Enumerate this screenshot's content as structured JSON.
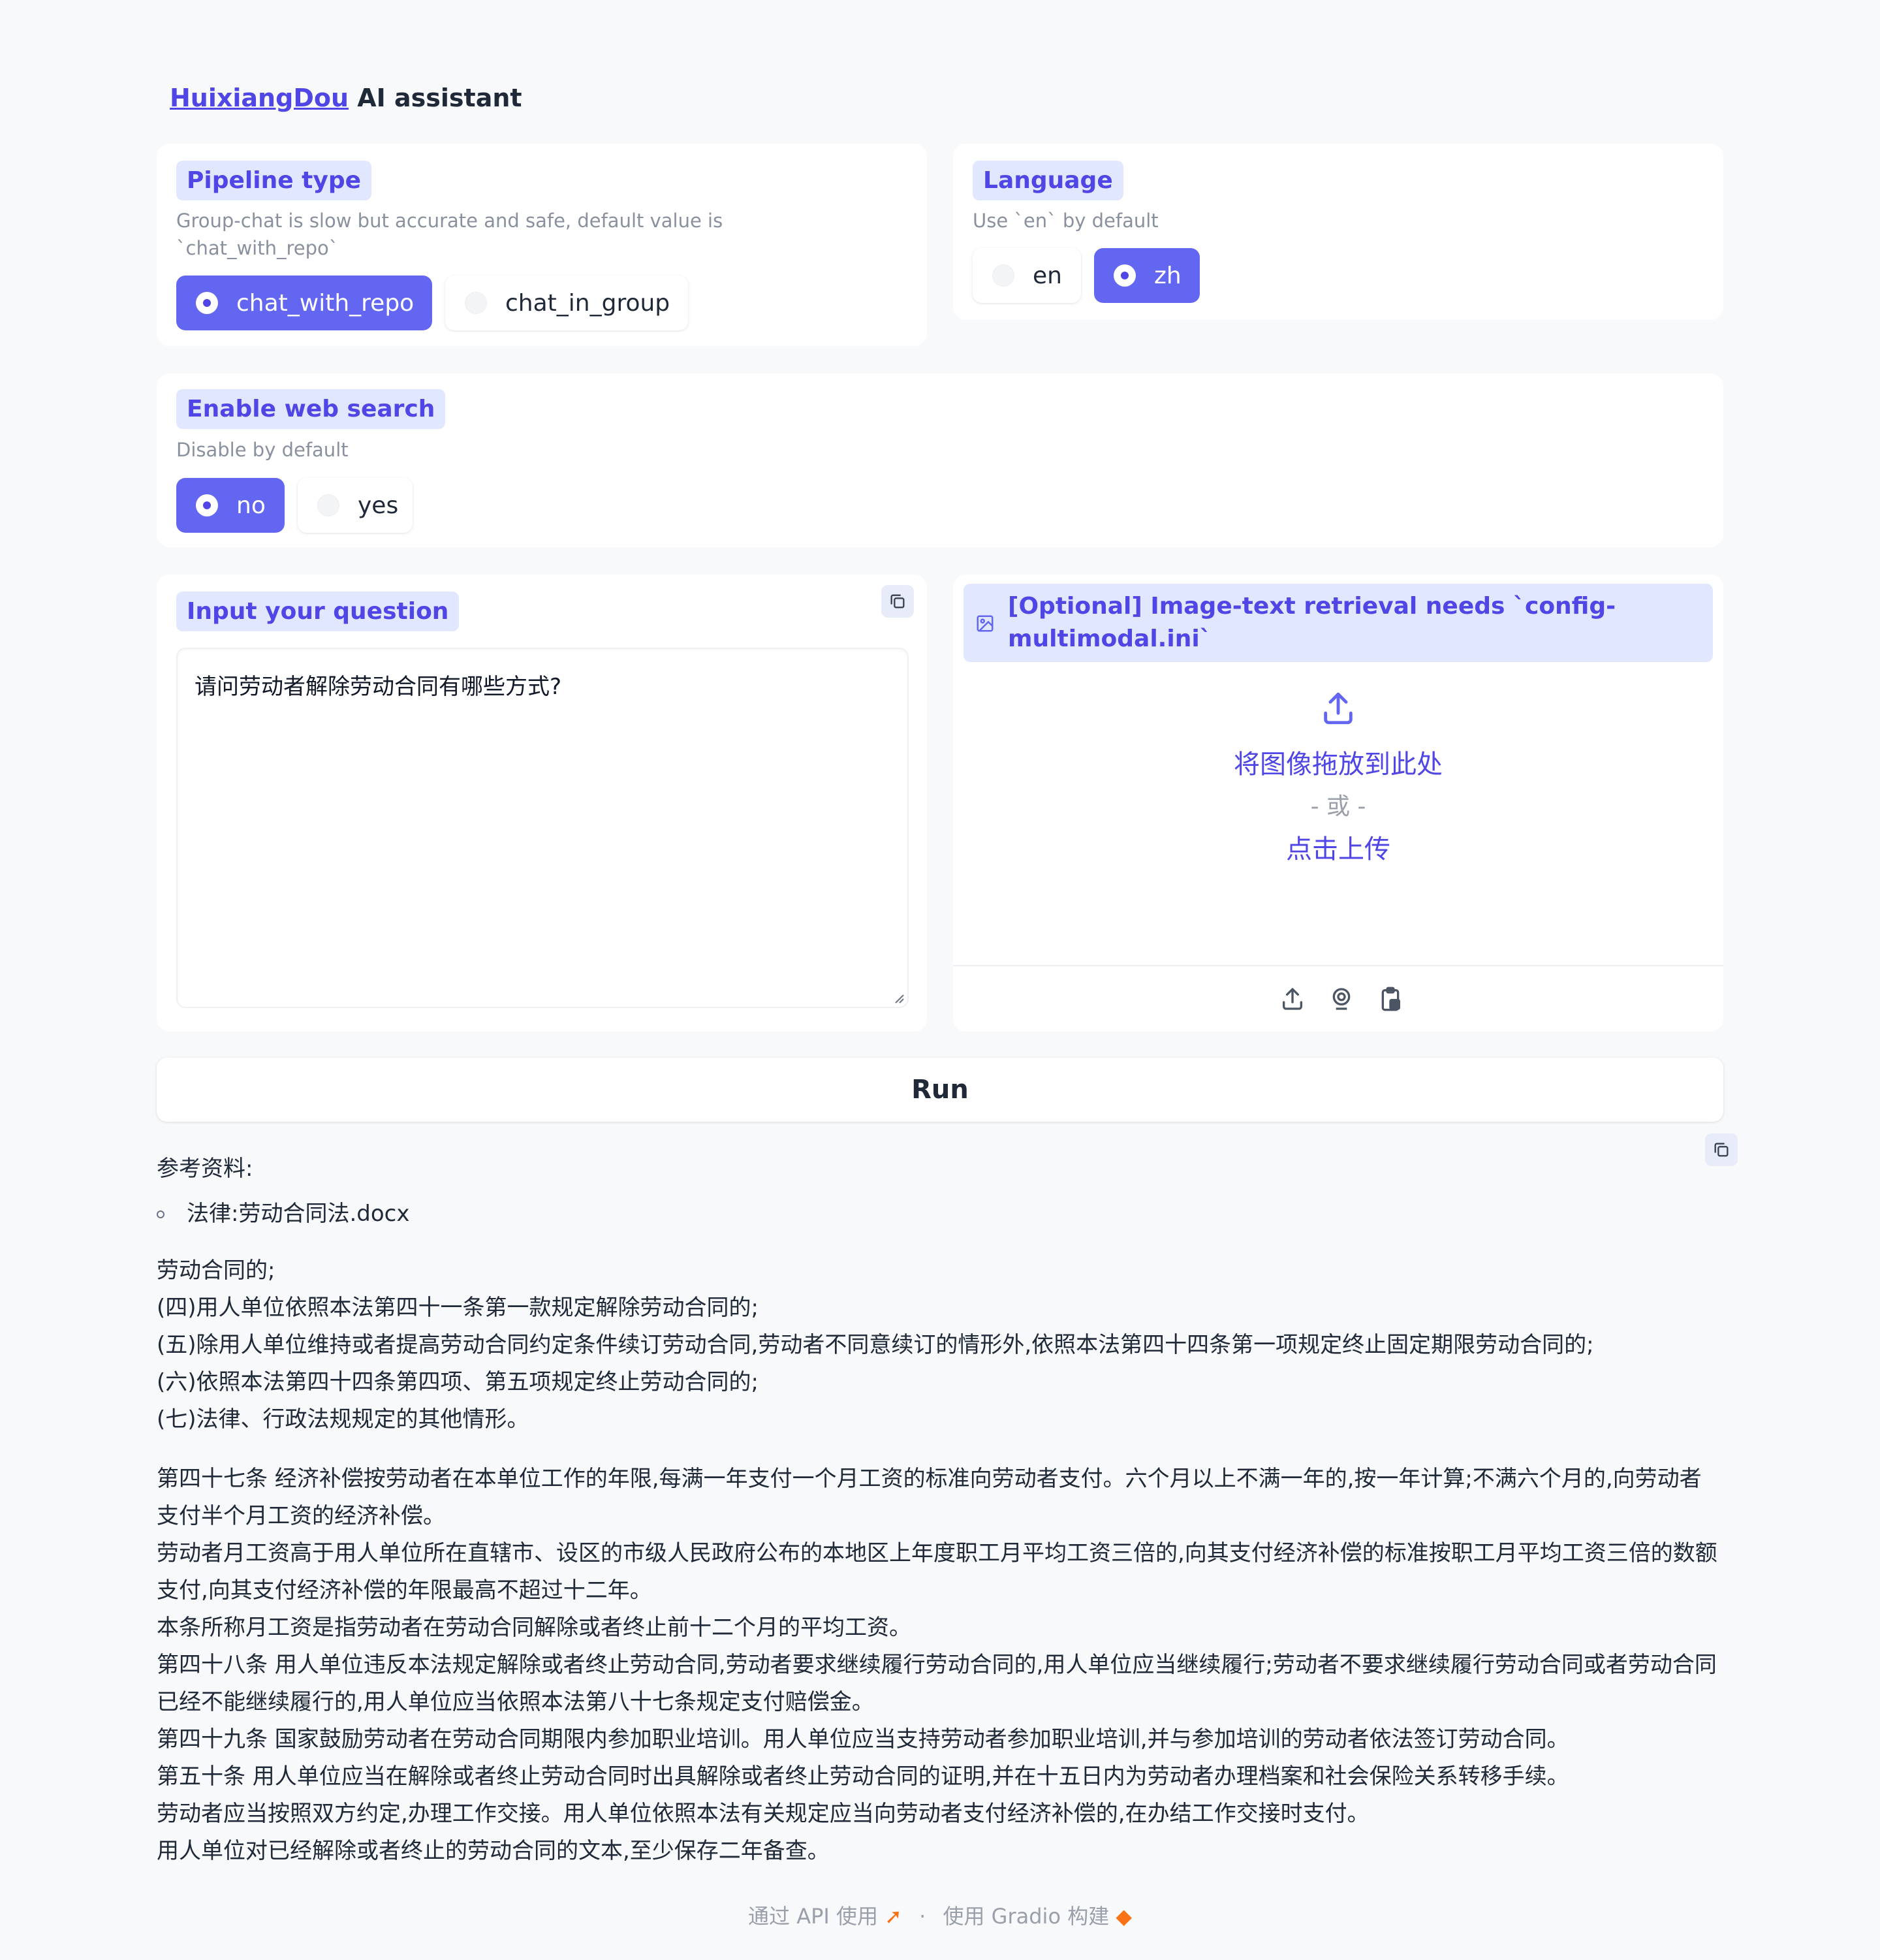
{
  "header": {
    "brand": "HuixiangDou",
    "suffix": " AI assistant"
  },
  "pipeline": {
    "label": "Pipeline type",
    "info_line1": "Group-chat is slow but accurate and safe, default value is",
    "info_line2": "`chat_with_repo`",
    "options": [
      "chat_with_repo",
      "chat_in_group"
    ],
    "selected": "chat_with_repo"
  },
  "language": {
    "label": "Language",
    "info": "Use `en` by default",
    "options": [
      "en",
      "zh"
    ],
    "selected": "zh"
  },
  "web_search": {
    "label": "Enable web search",
    "info": "Disable by default",
    "options": [
      "no",
      "yes"
    ],
    "selected": "no"
  },
  "question": {
    "label": "Input your question",
    "value": "请问劳动者解除劳动合同有哪些方式?"
  },
  "image_upload": {
    "label_line1": "[Optional] Image-text retrieval needs `config-",
    "label_line2": "multimodal.ini`",
    "drop_text": "将图像拖放到此处",
    "or_text": "- 或 -",
    "click_text": "点击上传",
    "icons": [
      "upload-icon",
      "webcam-icon",
      "clipboard-icon"
    ]
  },
  "run_button": {
    "label": "Run"
  },
  "output": {
    "ref_heading": "参考资料:",
    "ref_item": "法律:劳动合同法.docx",
    "para1": [
      "劳动合同的;",
      "(四)用人单位依照本法第四十一条第一款规定解除劳动合同的;",
      "(五)除用人单位维持或者提高劳动合同约定条件续订劳动合同,劳动者不同意续订的情形外,依照本法第四十四条第一项规定终止固定期限劳动合同的;",
      "(六)依照本法第四十四条第四项、第五项规定终止劳动合同的;",
      "(七)法律、行政法规规定的其他情形。"
    ],
    "para2": [
      "第四十七条 经济补偿按劳动者在本单位工作的年限,每满一年支付一个月工资的标准向劳动者支付。六个月以上不满一年的,按一年计算;不满六个月的,向劳动者支付半个月工资的经济补偿。",
      "劳动者月工资高于用人单位所在直辖市、设区的市级人民政府公布的本地区上年度职工月平均工资三倍的,向其支付经济补偿的标准按职工月平均工资三倍的数额支付,向其支付经济补偿的年限最高不超过十二年。",
      "本条所称月工资是指劳动者在劳动合同解除或者终止前十二个月的平均工资。",
      "第四十八条 用人单位违反本法规定解除或者终止劳动合同,劳动者要求继续履行劳动合同的,用人单位应当继续履行;劳动者不要求继续履行劳动合同或者劳动合同已经不能继续履行的,用人单位应当依照本法第八十七条规定支付赔偿金。",
      "第四十九条 国家鼓励劳动者在劳动合同期限内参加职业培训。用人单位应当支持劳动者参加职业培训,并与参加培训的劳动者依法签订劳动合同。",
      "第五十条 用人单位应当在解除或者终止劳动合同时出具解除或者终止劳动合同的证明,并在十五日内为劳动者办理档案和社会保险关系转移手续。",
      "劳动者应当按照双方约定,办理工作交接。用人单位依照本法有关规定应当向劳动者支付经济补偿的,在办结工作交接时支付。",
      "用人单位对已经解除或者终止的劳动合同的文本,至少保存二年备查。"
    ]
  },
  "footer": {
    "api_text": "通过 API 使用",
    "separator": "·",
    "built_text": "使用 Gradio 构建"
  },
  "colors": {
    "accent": "#6366f1",
    "accent_dark": "#4f46e5",
    "tag_bg": "#e0e7ff",
    "page_bg": "#f8f9fb"
  }
}
